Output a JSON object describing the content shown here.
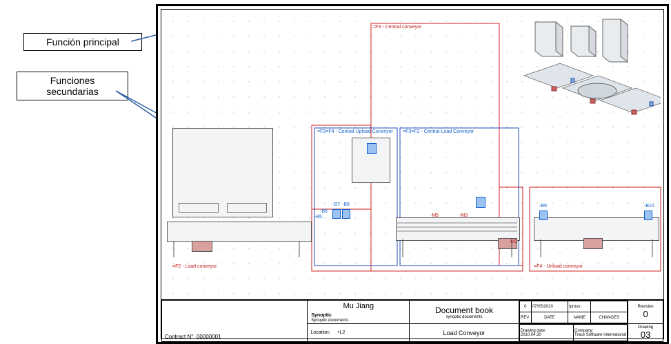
{
  "callouts": {
    "principal": "Función principal",
    "secundarias": "Funciones\nsecundarias"
  },
  "zones": {
    "f3": "=F3 - Central conveyor",
    "f3f4": "=F3=F4 - Central-Upload Conveyor",
    "f3f2": "=F3=F2 - Central-Load Conveyor",
    "f2": "=F2 - Load conveyor",
    "f4": "=F4 - Unload conveyor"
  },
  "sensors": {
    "b7": "-B7",
    "b8": "-B8",
    "b6": "-B6",
    "b5": "-B5",
    "m5": "-M5",
    "m3": "-M3",
    "m2": "-M2",
    "b9": "-B9",
    "b10": "-B10"
  },
  "titleblock": {
    "contract_lbl": "Contract N°",
    "contract_no": "00000001",
    "author": "Mu Jiang",
    "section": "Synoptic",
    "subsection": "Synoptic documents",
    "doc_title": "Document book",
    "doc_sub": "synoptic documents",
    "location_lbl": "Location:",
    "location": "+L2",
    "page_name": "Load Conveyor",
    "rev_lbl": "Revision",
    "rev_val": "0",
    "draw_lbl": "Drawing",
    "draw_val": "03",
    "rev_cols": {
      "rev": "REV.",
      "date": "DATE",
      "name": "NAME",
      "changes": "CHANGES"
    },
    "rev_row": {
      "num": "0",
      "date": "07/05/2010",
      "name": "lproux"
    },
    "ddate_lbl": "Drawing date:",
    "ddate": "2010.04.30",
    "company_lbl": "Company:",
    "company": "Trace Software International"
  }
}
